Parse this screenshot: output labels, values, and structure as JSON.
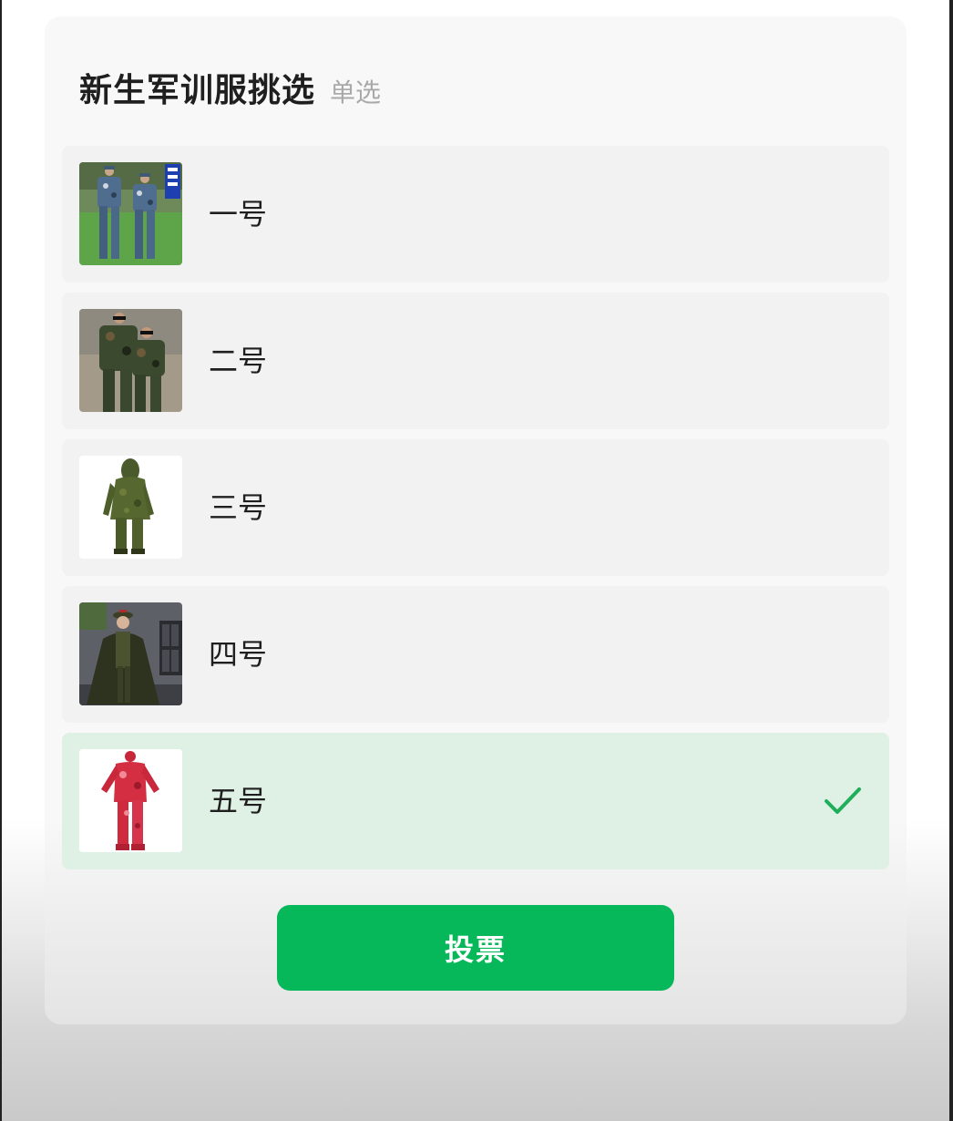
{
  "poll": {
    "title": "新生军训服挑选",
    "mode_label": "单选",
    "options": [
      {
        "label": "一号",
        "selected": false
      },
      {
        "label": "二号",
        "selected": false
      },
      {
        "label": "三号",
        "selected": false
      },
      {
        "label": "四号",
        "selected": false
      },
      {
        "label": "五号",
        "selected": true
      }
    ],
    "vote_label": "投票"
  },
  "colors": {
    "accent": "#07b85a",
    "selected_bg": "#dff0e5",
    "option_bg": "#f2f2f2",
    "check": "#1fae5a"
  },
  "icons": {
    "selected_indicator": "checkmark-icon"
  }
}
